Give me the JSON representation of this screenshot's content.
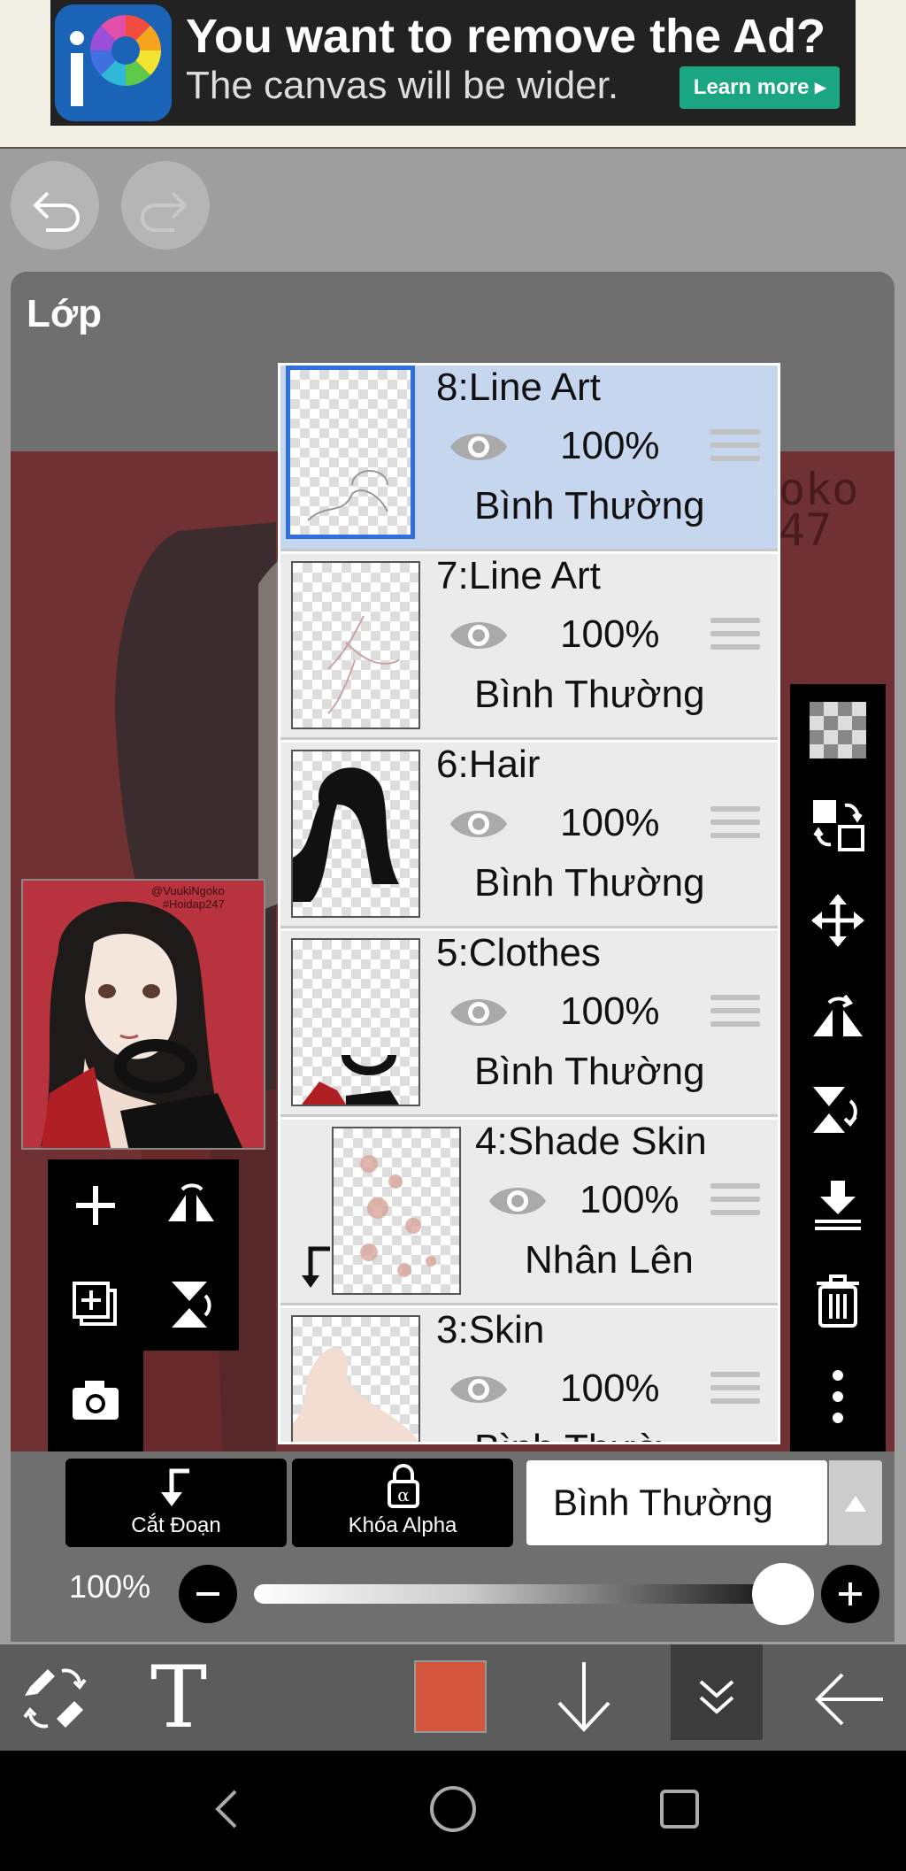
{
  "ad": {
    "title": "You want to remove the Ad?",
    "subtitle": "The canvas will be wider.",
    "cta": "Learn more ▸"
  },
  "panel": {
    "title": "Lớp"
  },
  "layers": [
    {
      "name": "8:Line Art",
      "opacity": "100%",
      "blend": "Bình Thường",
      "selected": true
    },
    {
      "name": "7:Line Art",
      "opacity": "100%",
      "blend": "Bình Thường"
    },
    {
      "name": "6:Hair",
      "opacity": "100%",
      "blend": "Bình Thường"
    },
    {
      "name": "5:Clothes",
      "opacity": "100%",
      "blend": "Bình Thường"
    },
    {
      "name": "4:Shade Skin",
      "opacity": "100%",
      "blend": "Nhân Lên",
      "clipped": true
    },
    {
      "name": "3:Skin",
      "opacity": "100%",
      "blend": "Bình Thườ..."
    }
  ],
  "controls": {
    "clip_label": "Cắt Đoạn",
    "alpha_lock_label": "Khóa Alpha",
    "blend_mode": "Bình Thường",
    "opacity_label": "100%",
    "opacity_value": 1.0
  },
  "preview": {
    "watermark_line1": "@VuukiNgoko",
    "watermark_line2": "#Hoidap247"
  },
  "colors": {
    "current_color": "#d2573c",
    "canvas_bg": "#b8333d",
    "selected_layer": "#c7d6ef"
  }
}
